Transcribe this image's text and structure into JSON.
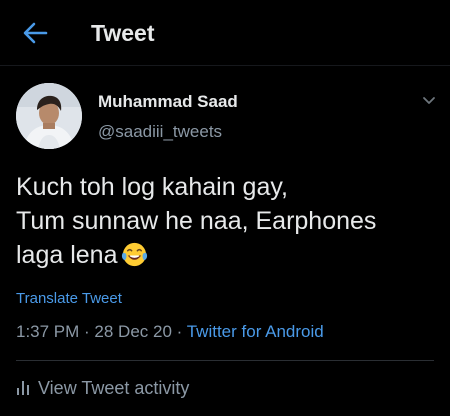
{
  "header": {
    "title": "Tweet",
    "back_icon": "arrow-left-icon",
    "accent_color": "#4a9ae8"
  },
  "tweet": {
    "author": {
      "name": "Muhammad Saad",
      "handle": "@saadiii_tweets"
    },
    "text_lines": [
      "Kuch toh log kahain gay,",
      "Tum sunnaw he naa, Earphones",
      "laga lena"
    ],
    "emoji_icon": "laughing-tears-emoji-icon",
    "translate_label": "Translate Tweet",
    "time": "1:37 PM",
    "date": "28 Dec 20",
    "source": "Twitter for Android",
    "separator": " · "
  },
  "activity": {
    "label": "View Tweet activity",
    "icon": "bar-chart-icon"
  }
}
